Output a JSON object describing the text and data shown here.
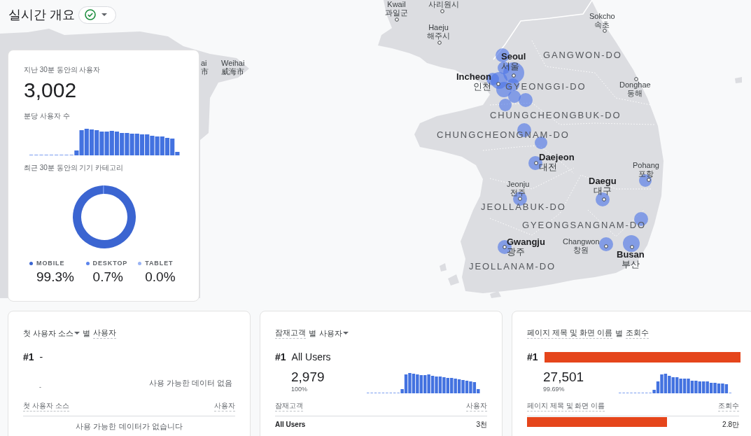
{
  "header": {
    "title": "실시간 개요"
  },
  "map": {
    "labels": [
      {
        "name": "Kwail",
        "local": "과일군",
        "kind": "minor"
      },
      {
        "name": "사리원시",
        "kind": "minor"
      },
      {
        "name": "Haeju",
        "local": "해주시",
        "kind": "minor"
      },
      {
        "name": "Sokcho",
        "local": "속초",
        "kind": "minor"
      },
      {
        "name": "Weihai",
        "local": "威海市",
        "kind": "minor"
      },
      {
        "name": "ai",
        "local": "市",
        "kind": "minor"
      },
      {
        "name": "Seoul",
        "local": "서울",
        "kind": "major"
      },
      {
        "name": "Incheon",
        "local": "인천",
        "kind": "major"
      },
      {
        "name": "GANGWON-DO",
        "kind": "province"
      },
      {
        "name": "GYEONGGI-DO",
        "kind": "province"
      },
      {
        "name": "Donghae",
        "local": "동해",
        "kind": "minor"
      },
      {
        "name": "CHUNGCHEONGBUK-DO",
        "kind": "province"
      },
      {
        "name": "CHUNGCHEONGNAM-DO",
        "kind": "province"
      },
      {
        "name": "Daejeon",
        "local": "대전",
        "kind": "major"
      },
      {
        "name": "Pohang",
        "local": "포항",
        "kind": "minor"
      },
      {
        "name": "Daegu",
        "local": "대구",
        "kind": "major"
      },
      {
        "name": "Jeonju",
        "local": "전주",
        "kind": "minor"
      },
      {
        "name": "JEOLLABUK-DO",
        "kind": "province"
      },
      {
        "name": "GYEONGSANGNAM-DO",
        "kind": "province"
      },
      {
        "name": "Gwangju",
        "local": "광주",
        "kind": "major"
      },
      {
        "name": "Changwon",
        "local": "창원",
        "kind": "minor"
      },
      {
        "name": "Busan",
        "local": "부산",
        "kind": "major"
      },
      {
        "name": "JEOLLANAM-DO",
        "kind": "province"
      }
    ]
  },
  "users_card": {
    "title": "지난 30분 동안의 사용자",
    "total": "3,002",
    "per_minute_label": "분당 사용자 수",
    "device_title": "최근 30분 동안의 기기 카테고리",
    "chart_data": {
      "type": "donut",
      "categories": [
        "MOBILE",
        "DESKTOP",
        "TABLET"
      ],
      "values": [
        99.3,
        0.7,
        0.0
      ],
      "value_labels": [
        "99.3%",
        "0.7%",
        "0.0%"
      ],
      "legend": "bottom"
    },
    "segments": [
      {
        "color": "#3b65d1"
      },
      {
        "color": "#5b84ec"
      },
      {
        "color": "#9ab4f4"
      }
    ]
  },
  "cards": [
    {
      "kind": "empty",
      "title_parts": [
        {
          "text": "첫 사용자 소스",
          "kind": "dropdown"
        },
        {
          "text": "별",
          "kind": "plain"
        },
        {
          "text": "사용자",
          "kind": "metric"
        }
      ],
      "top": {
        "rank": "#1",
        "name": "-",
        "redacted": false,
        "value": "-"
      },
      "chart_message": "사용 가능한 데이터 없음",
      "columns": [
        "첫 사용자 소스",
        "사용자"
      ],
      "table_message": "사용 가능한 데이터가 없습니다"
    },
    {
      "kind": "data",
      "title_parts": [
        {
          "text": "잠재고객",
          "kind": "metric"
        },
        {
          "text": "별",
          "kind": "plain"
        },
        {
          "text": "사용자",
          "kind": "dropdown"
        }
      ],
      "top": {
        "rank": "#1",
        "name": "All Users",
        "redacted": false,
        "value": "2,979",
        "share": "100%"
      },
      "columns": [
        "잠재고객",
        "사용자"
      ],
      "rows": [
        {
          "name": "All Users",
          "redacted": false,
          "value": "3천"
        }
      ]
    },
    {
      "kind": "data",
      "title_parts": [
        {
          "text": "페이지 제목 및 화면 이름",
          "kind": "metric"
        },
        {
          "text": "별",
          "kind": "plain"
        },
        {
          "text": "조회수",
          "kind": "metric"
        }
      ],
      "top": {
        "rank": "#1",
        "redacted": true,
        "value": "27,501",
        "share": "99.69%"
      },
      "columns": [
        "페이지 제목 및 화면 이름",
        "조회수"
      ],
      "rows": [
        {
          "redacted": true,
          "value": "2.8만"
        }
      ]
    }
  ]
}
